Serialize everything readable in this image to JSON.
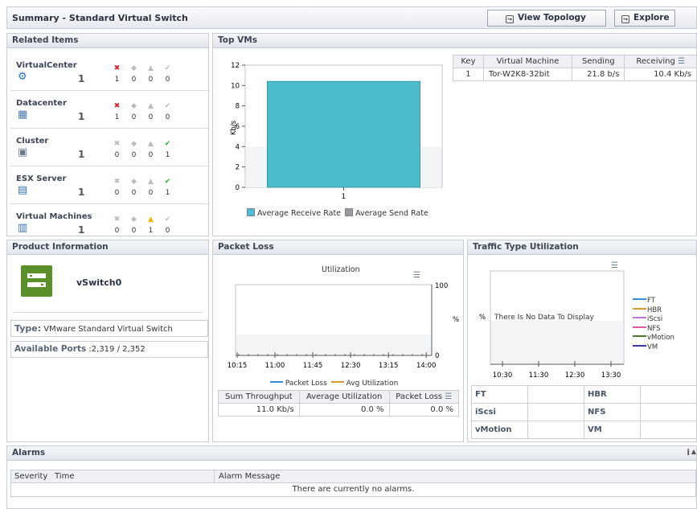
{
  "header": {
    "title": "Summary - Standard Virtual Switch",
    "view_topology": "View Topology",
    "explore": "Explore"
  },
  "related_items": {
    "title": "Related Items",
    "items": [
      {
        "name": "VirtualCenter",
        "count": "1",
        "icon": "vcenter-icon",
        "counts": [
          "1",
          "0",
          "0",
          "0"
        ],
        "states": [
          "critical",
          "warning-off",
          "minor-off",
          "ok-off"
        ]
      },
      {
        "name": "Datacenter",
        "count": "1",
        "icon": "datacenter-icon",
        "counts": [
          "1",
          "0",
          "0",
          "0"
        ],
        "states": [
          "critical",
          "warning-off",
          "minor-off",
          "ok-off"
        ]
      },
      {
        "name": "Cluster",
        "count": "1",
        "icon": "cluster-icon",
        "counts": [
          "0",
          "0",
          "0",
          "1"
        ],
        "states": [
          "critical-off",
          "warning-off",
          "minor-off",
          "ok"
        ]
      },
      {
        "name": "ESX Server",
        "count": "1",
        "icon": "esx-server-icon",
        "counts": [
          "0",
          "0",
          "0",
          "1"
        ],
        "states": [
          "critical-off",
          "warning-off",
          "minor-off",
          "ok"
        ]
      },
      {
        "name": "Virtual Machines",
        "count": "1",
        "icon": "virtual-machines-icon",
        "counts": [
          "0",
          "0",
          "1",
          "0"
        ],
        "states": [
          "critical-off",
          "warning-off",
          "minor",
          "ok-off"
        ]
      }
    ]
  },
  "top_vms": {
    "title": "Top VMs",
    "ylabel": "Kb/s",
    "table": {
      "headers": [
        "Key",
        "Virtual Machine",
        "Sending",
        "Receiving"
      ],
      "rows": [
        [
          "1",
          "Tor-W2K8-32bit",
          "21.8 b/s",
          "10.4 Kb/s"
        ]
      ]
    },
    "legend": [
      "Average Receive Rate",
      "Average Send Rate"
    ]
  },
  "chart_data": [
    {
      "type": "bar",
      "categories": [
        "1"
      ],
      "series": [
        {
          "name": "Average Receive Rate",
          "values": [
            10.4
          ],
          "color": "#4bbccb"
        },
        {
          "name": "Average Send Rate",
          "values": [
            0.02
          ],
          "color": "#9a9a9a"
        }
      ],
      "ylabel": "Kb/s",
      "ylim": [
        0,
        12
      ],
      "yticks": [
        "0",
        "2",
        "4",
        "6",
        "8",
        "10",
        "12"
      ]
    },
    {
      "type": "line",
      "title": "Utilization",
      "x": [
        "10:15",
        "11:00",
        "11:45",
        "12:30",
        "13:15",
        "14:00"
      ],
      "ylabel": "%",
      "ylim": [
        0,
        100
      ],
      "series": [
        {
          "name": "Packet Loss",
          "values": [],
          "color": "#3a8fd6"
        },
        {
          "name": "Avg Utilization",
          "values": [],
          "color": "#d89a2c"
        }
      ]
    },
    {
      "type": "line",
      "x": [
        "10:30",
        "11:30",
        "12:30",
        "13:30"
      ],
      "ylabel": "%",
      "empty_message": "There Is No Data To Display",
      "series": [
        {
          "name": "FT",
          "values": [],
          "color": "#3a8fd6"
        },
        {
          "name": "HBR",
          "values": [],
          "color": "#d89a2c"
        },
        {
          "name": "iScsi",
          "values": [],
          "color": "#b57ad6"
        },
        {
          "name": "NFS",
          "values": [],
          "color": "#e65aa0"
        },
        {
          "name": "vMotion",
          "values": [],
          "color": "#4a7a2a"
        },
        {
          "name": "VM",
          "values": [],
          "color": "#3a3aa8"
        }
      ]
    }
  ],
  "product_info": {
    "title": "Product Information",
    "name": "vSwitch0",
    "type_label": "Type:",
    "type_value": "VMware Standard Virtual Switch",
    "ports_label": "Available Ports",
    "ports_value": ":2,319 / 2,352"
  },
  "packet_loss": {
    "title": "Packet Loss",
    "table_headers": [
      "Sum Throughput",
      "Average Utilization",
      "Packet Loss"
    ],
    "table_row": [
      "11.0 Kb/s",
      "0.0 %",
      "0.0 %"
    ]
  },
  "traffic": {
    "title": "Traffic Type Utilization",
    "grid": [
      [
        "FT",
        "",
        "HBR",
        ""
      ],
      [
        "iScsi",
        "",
        "NFS",
        ""
      ],
      [
        "vMotion",
        "",
        "VM",
        ""
      ]
    ]
  },
  "alarms": {
    "title": "Alarms",
    "info_icon_text": "i",
    "headers": [
      "Severity",
      "Time",
      "Alarm Message"
    ],
    "empty": "There are currently no alarms."
  },
  "colors": {
    "accent": "#4bbccb",
    "product_icon_bg": "#5a8f2a",
    "critical": "#d9262b",
    "ok": "#3aa34a",
    "minor": "#f0b400"
  }
}
